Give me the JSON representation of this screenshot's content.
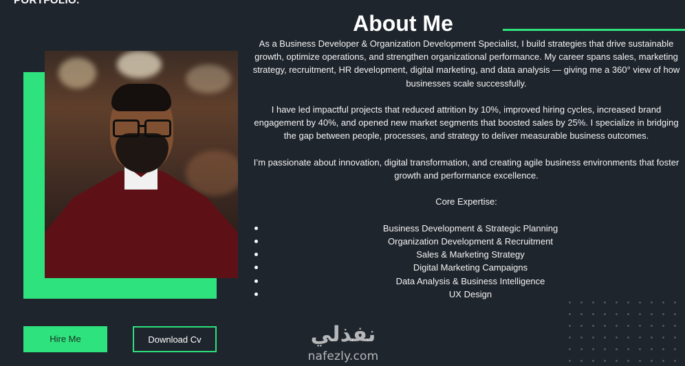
{
  "brand": {
    "label": "PORTFOLIO."
  },
  "about": {
    "title": "About Me",
    "paragraphs": [
      "As a Business Developer & Organization Development Specialist, I build strategies that drive sustainable growth, optimize operations, and strengthen organizational performance. My career spans sales, marketing strategy, recruitment, HR development, digital marketing, and data analysis — giving me a 360° view of how businesses scale successfully.",
      "I have led impactful projects that reduced attrition by 10%, improved hiring cycles, increased brand engagement by 40%, and opened new market segments that boosted sales by 25%. I specialize in bridging the gap between people, processes, and strategy to deliver measurable business outcomes.",
      "I’m passionate about innovation, digital transformation, and creating agile business environments that foster growth and performance excellence."
    ],
    "expertise_title": "Core Expertise:",
    "expertise_items": [
      "Business Development & Strategic Planning",
      "Organization Development & Recruitment",
      "Sales & Marketing Strategy",
      "Digital Marketing Campaigns",
      "Data Analysis & Business Intelligence",
      "UX Design"
    ]
  },
  "buttons": {
    "hire": "Hire Me",
    "download": "Download Cv"
  },
  "watermark": {
    "arabic": "نفذلي",
    "latin": "nafezly.com"
  },
  "colors": {
    "background": "#1f252d",
    "accent": "#2ee27d",
    "text": "#ffffff"
  },
  "icons": {
    "list_bullet": "bullet-dot-icon"
  }
}
